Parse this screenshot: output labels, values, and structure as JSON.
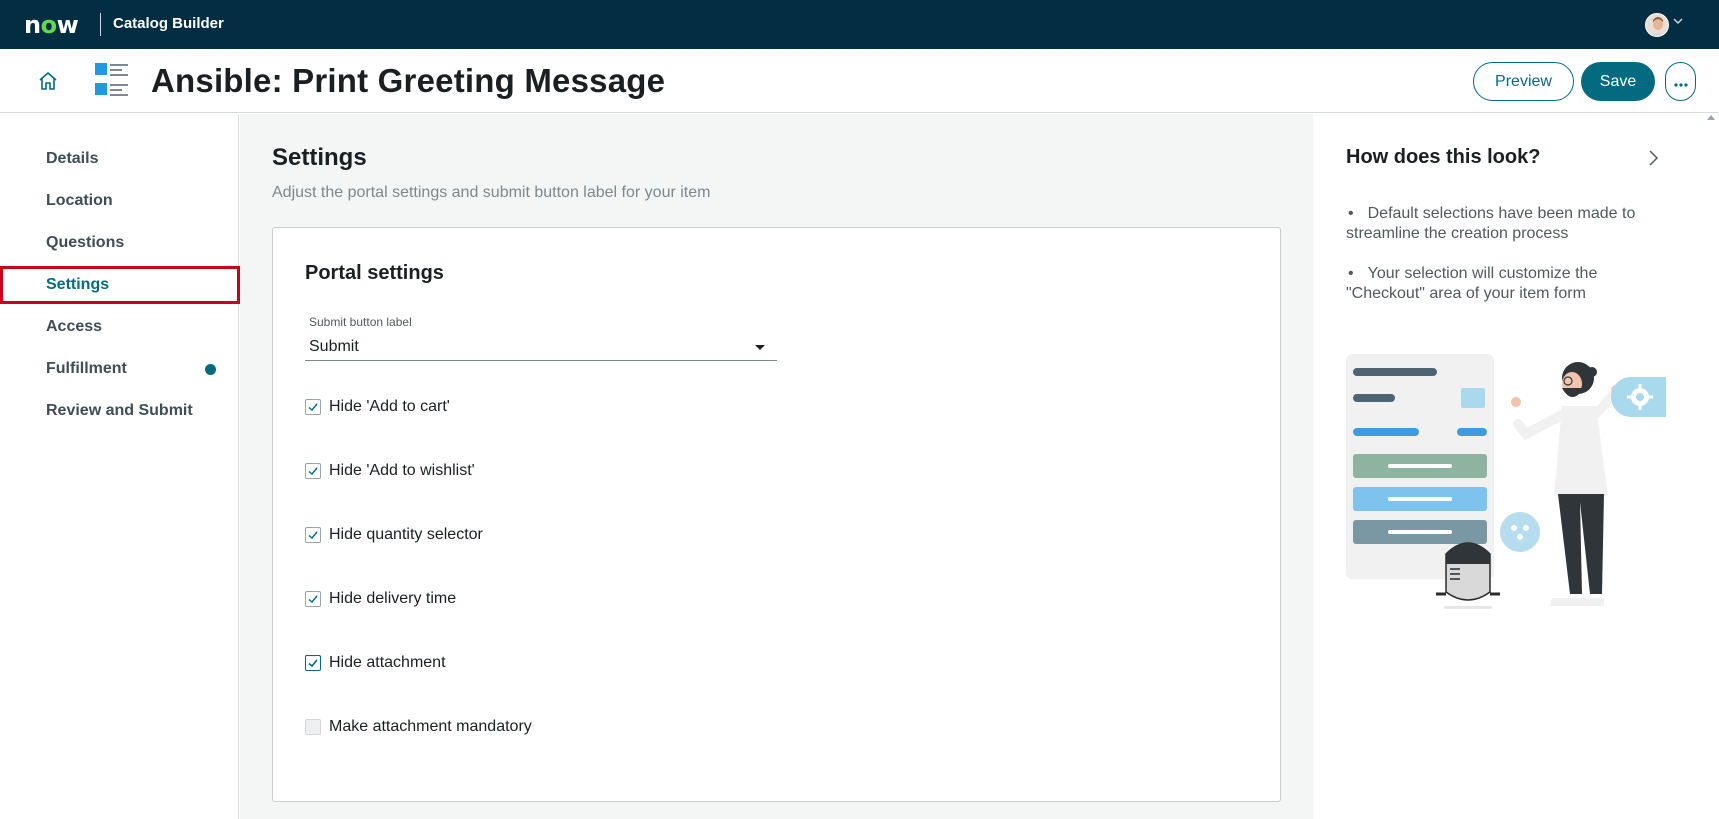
{
  "topbar": {
    "logo_text_prefix": "n",
    "logo_text_o": "o",
    "logo_text_suffix": "w",
    "app_name": "Catalog Builder"
  },
  "header": {
    "title": "Ansible: Print Greeting Message",
    "preview_label": "Preview",
    "save_label": "Save",
    "more_label": "···"
  },
  "nav": {
    "items": [
      {
        "label": "Details"
      },
      {
        "label": "Location"
      },
      {
        "label": "Questions"
      },
      {
        "label": "Settings",
        "active": true
      },
      {
        "label": "Access"
      },
      {
        "label": "Fulfillment",
        "has_dot": true
      },
      {
        "label": "Review and Submit"
      }
    ]
  },
  "main": {
    "title": "Settings",
    "subtitle": "Adjust the portal settings and submit button label for your item",
    "card": {
      "title": "Portal settings",
      "submit_label_field": "Submit button label",
      "submit_label_value": "Submit",
      "checkboxes": [
        {
          "label": "Hide 'Add to cart'",
          "checked": true
        },
        {
          "label": "Hide 'Add to wishlist'",
          "checked": true
        },
        {
          "label": "Hide quantity selector",
          "checked": true
        },
        {
          "label": "Hide delivery time",
          "checked": true
        },
        {
          "label": "Hide attachment",
          "checked": true
        },
        {
          "label": "Make attachment mandatory",
          "checked": false
        }
      ]
    }
  },
  "right_panel": {
    "title": "How does this look?",
    "bullets": [
      "Default selections have been made to streamline the creation process",
      "Your selection will customize the \"Checkout\" area of your item form"
    ]
  },
  "colors": {
    "topbar": "#032d42",
    "accent": "#046a80",
    "active_outline": "#c8001e",
    "logo_green": "#62d84e"
  }
}
